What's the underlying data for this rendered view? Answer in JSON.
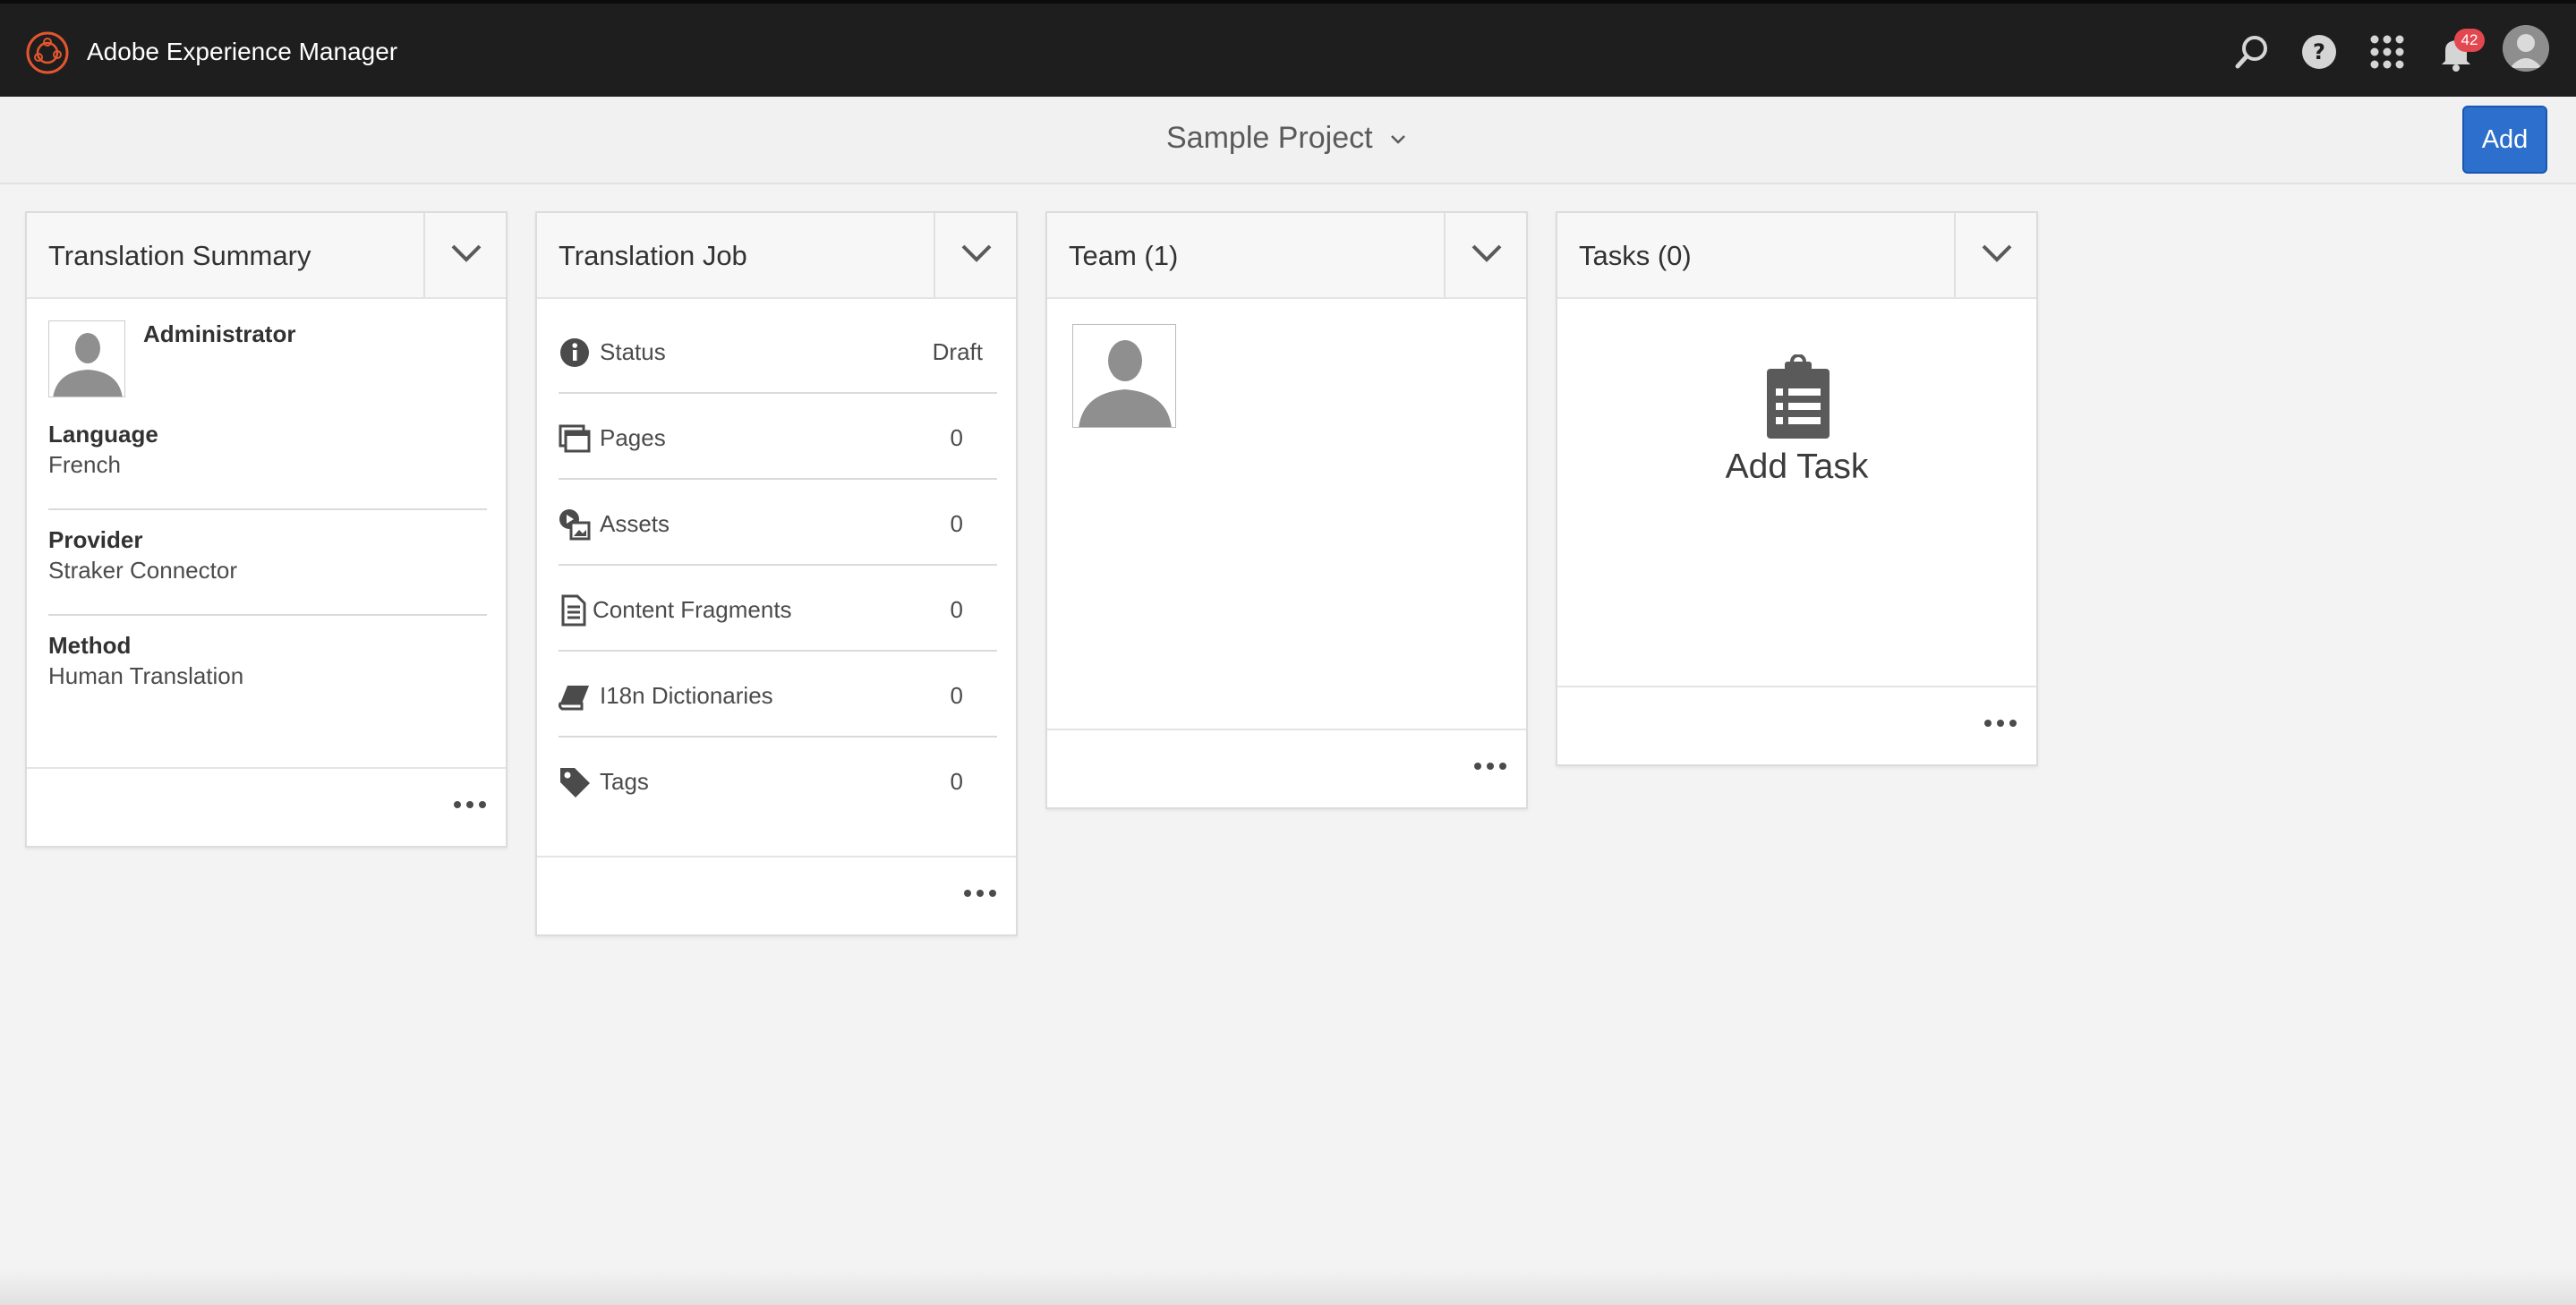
{
  "shell": {
    "brand": "Adobe Experience Manager",
    "notification_count": "42"
  },
  "actionbar": {
    "project_title": "Sample Project",
    "add_label": "Add"
  },
  "cards": {
    "summary": {
      "title": "Translation Summary",
      "user": "Administrator",
      "fields": [
        {
          "label": "Language",
          "value": "French"
        },
        {
          "label": "Provider",
          "value": "Straker Connector"
        },
        {
          "label": "Method",
          "value": "Human Translation"
        }
      ]
    },
    "job": {
      "title": "Translation Job",
      "rows": [
        {
          "icon": "info-icon",
          "label": "Status",
          "value": "Draft"
        },
        {
          "icon": "pages-icon",
          "label": "Pages",
          "value": "0"
        },
        {
          "icon": "assets-icon",
          "label": "Assets",
          "value": "0"
        },
        {
          "icon": "content-fragments-icon",
          "label": "Content Fragments",
          "value": "0"
        },
        {
          "icon": "dictionary-icon",
          "label": "I18n Dictionaries",
          "value": "0"
        },
        {
          "icon": "tag-icon",
          "label": "Tags",
          "value": "0"
        }
      ]
    },
    "team": {
      "title": "Team (1)"
    },
    "tasks": {
      "title": "Tasks (0)",
      "add_task": "Add Task"
    }
  },
  "colors": {
    "shell": "#1e1e1e",
    "accent": "#2d6fcc",
    "badge": "#e34850",
    "logo": "#e3562e"
  }
}
